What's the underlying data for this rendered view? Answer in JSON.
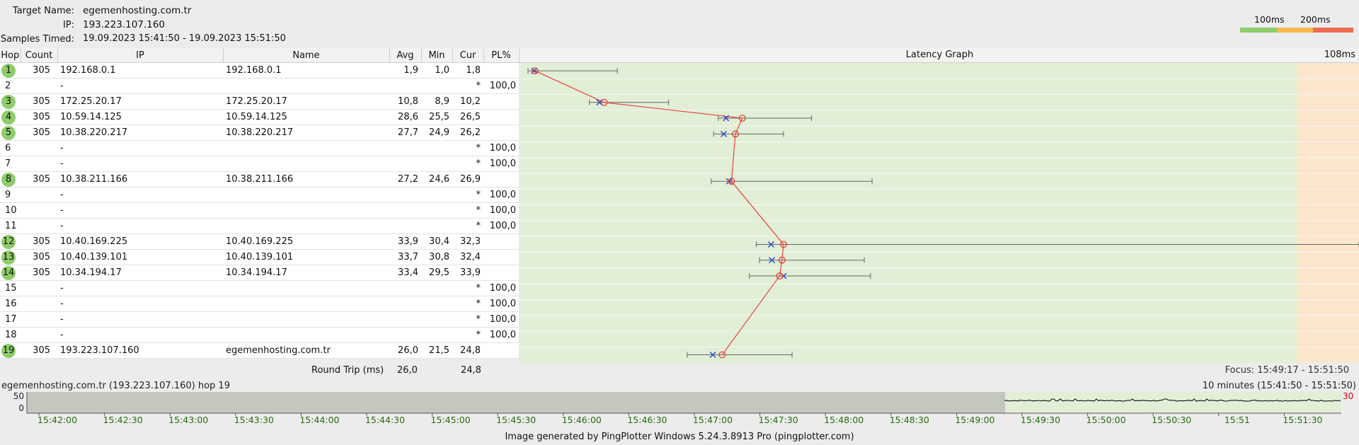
{
  "header": {
    "target_label": "Target Name:",
    "target": "egemenhosting.com.tr",
    "ip_label": "IP:",
    "ip": "193.223.107.160",
    "samples_label": "Samples Timed:",
    "samples": "19.09.2023 15:41:50 - 19.09.2023 15:51:50"
  },
  "legend": {
    "t1": "100ms",
    "t2": "200ms",
    "colors": [
      "#8fcc6b",
      "#fbb84a",
      "#f26b50"
    ]
  },
  "columns": {
    "hop": "Hop",
    "count": "Count",
    "ip": "IP",
    "name": "Name",
    "avg": "Avg",
    "min": "Min",
    "cur": "Cur",
    "pl": "PL%",
    "graph": "Latency Graph",
    "graph_max": "108ms"
  },
  "hops": [
    {
      "hop": "1",
      "count": "305",
      "ip": "192.168.0.1",
      "name": "192.168.0.1",
      "avg": "1,9",
      "min": "1,0",
      "cur": "1,8",
      "pl": "",
      "ok": true,
      "avg_ms": 1.9,
      "min_ms": 1.0,
      "cur_ms": 1.8,
      "max_ms": 12.5
    },
    {
      "hop": "2",
      "count": "",
      "ip": "-",
      "name": "",
      "avg": "",
      "min": "",
      "cur": "*",
      "pl": "100,0",
      "ok": false
    },
    {
      "hop": "3",
      "count": "305",
      "ip": "172.25.20.17",
      "name": "172.25.20.17",
      "avg": "10,8",
      "min": "8,9",
      "cur": "10,2",
      "pl": "",
      "ok": true,
      "avg_ms": 10.8,
      "min_ms": 8.9,
      "cur_ms": 10.2,
      "max_ms": 19.1
    },
    {
      "hop": "4",
      "count": "305",
      "ip": "10.59.14.125",
      "name": "10.59.14.125",
      "avg": "28,6",
      "min": "25,5",
      "cur": "26,5",
      "pl": "",
      "ok": true,
      "avg_ms": 28.6,
      "min_ms": 25.5,
      "cur_ms": 26.5,
      "max_ms": 37.5
    },
    {
      "hop": "5",
      "count": "305",
      "ip": "10.38.220.217",
      "name": "10.38.220.217",
      "avg": "27,7",
      "min": "24,9",
      "cur": "26,2",
      "pl": "",
      "ok": true,
      "avg_ms": 27.7,
      "min_ms": 24.9,
      "cur_ms": 26.2,
      "max_ms": 33.9
    },
    {
      "hop": "6",
      "count": "",
      "ip": "-",
      "name": "",
      "avg": "",
      "min": "",
      "cur": "*",
      "pl": "100,0",
      "ok": false
    },
    {
      "hop": "7",
      "count": "",
      "ip": "-",
      "name": "",
      "avg": "",
      "min": "",
      "cur": "*",
      "pl": "100,0",
      "ok": false
    },
    {
      "hop": "8",
      "count": "305",
      "ip": "10.38.211.166",
      "name": "10.38.211.166",
      "avg": "27,2",
      "min": "24,6",
      "cur": "26,9",
      "pl": "",
      "ok": true,
      "avg_ms": 27.2,
      "min_ms": 24.6,
      "cur_ms": 26.9,
      "max_ms": 45.3
    },
    {
      "hop": "9",
      "count": "",
      "ip": "-",
      "name": "",
      "avg": "",
      "min": "",
      "cur": "*",
      "pl": "100,0",
      "ok": false
    },
    {
      "hop": "10",
      "count": "",
      "ip": "-",
      "name": "",
      "avg": "",
      "min": "",
      "cur": "*",
      "pl": "100,0",
      "ok": false
    },
    {
      "hop": "11",
      "count": "",
      "ip": "-",
      "name": "",
      "avg": "",
      "min": "",
      "cur": "*",
      "pl": "100,0",
      "ok": false
    },
    {
      "hop": "12",
      "count": "305",
      "ip": "10.40.169.225",
      "name": "10.40.169.225",
      "avg": "33,9",
      "min": "30,4",
      "cur": "32,3",
      "pl": "",
      "ok": true,
      "avg_ms": 33.9,
      "min_ms": 30.4,
      "cur_ms": 32.3,
      "max_ms": 108
    },
    {
      "hop": "13",
      "count": "305",
      "ip": "10.40.139.101",
      "name": "10.40.139.101",
      "avg": "33,7",
      "min": "30,8",
      "cur": "32,4",
      "pl": "",
      "ok": true,
      "avg_ms": 33.7,
      "min_ms": 30.8,
      "cur_ms": 32.4,
      "max_ms": 44.3
    },
    {
      "hop": "14",
      "count": "305",
      "ip": "10.34.194.17",
      "name": "10.34.194.17",
      "avg": "33,4",
      "min": "29,5",
      "cur": "33,9",
      "pl": "",
      "ok": true,
      "avg_ms": 33.4,
      "min_ms": 29.5,
      "cur_ms": 33.9,
      "max_ms": 45.1
    },
    {
      "hop": "15",
      "count": "",
      "ip": "-",
      "name": "",
      "avg": "",
      "min": "",
      "cur": "*",
      "pl": "100,0",
      "ok": false
    },
    {
      "hop": "16",
      "count": "",
      "ip": "-",
      "name": "",
      "avg": "",
      "min": "",
      "cur": "*",
      "pl": "100,0",
      "ok": false
    },
    {
      "hop": "17",
      "count": "",
      "ip": "-",
      "name": "",
      "avg": "",
      "min": "",
      "cur": "*",
      "pl": "100,0",
      "ok": false
    },
    {
      "hop": "18",
      "count": "",
      "ip": "-",
      "name": "",
      "avg": "",
      "min": "",
      "cur": "*",
      "pl": "100,0",
      "ok": false
    },
    {
      "hop": "19",
      "count": "305",
      "ip": "193.223.107.160",
      "name": "egemenhosting.com.tr",
      "avg": "26,0",
      "min": "21,5",
      "cur": "24,8",
      "pl": "",
      "ok": true,
      "avg_ms": 26.0,
      "min_ms": 21.5,
      "cur_ms": 24.8,
      "max_ms": 35.0
    }
  ],
  "graph_scale_max_ms": 108,
  "graph_threshold_ms": 100,
  "round_trip": {
    "label": "Round Trip (ms)",
    "avg": "26,0",
    "cur": "24,8"
  },
  "focus": "Focus: 15:49:17 - 15:51:50",
  "timeline": {
    "title": "egemenhosting.com.tr (193.223.107.160) hop 19",
    "range": "10 minutes (15:41:50 - 15:51:50)",
    "y_top": "50",
    "y_bottom": "0",
    "scale_label": "30",
    "ticks": [
      "15:42:00",
      "15:42:30",
      "15:43:00",
      "15:43:30",
      "15:44:00",
      "15:44:30",
      "15:45:00",
      "15:45:30",
      "15:46:00",
      "15:46:30",
      "15:47:00",
      "15:47:30",
      "15:48:00",
      "15:48:30",
      "15:49:00",
      "15:49:30",
      "15:50:00",
      "15:50:30",
      "15:51",
      "15:51:30"
    ]
  },
  "footer": "Image generated by PingPlotter Windows 5.24.3.8913 Pro (pingplotter.com)"
}
